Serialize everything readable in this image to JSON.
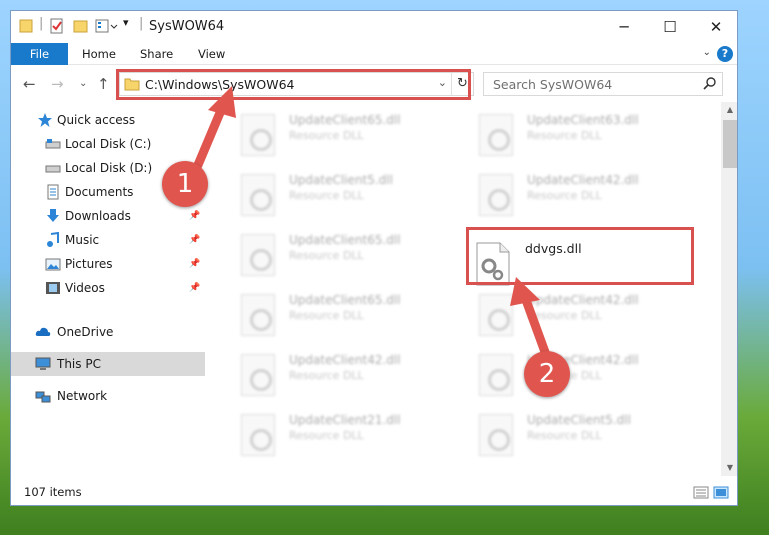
{
  "window": {
    "title": "SysWOW64"
  },
  "ribbon": {
    "tabs": [
      "File",
      "Home",
      "Share",
      "View"
    ]
  },
  "address": {
    "path": "C:\\Windows\\SysWOW64"
  },
  "search": {
    "placeholder": "Search SysWOW64"
  },
  "sidebar": {
    "items": [
      {
        "label": "Quick access",
        "icon": "star-icon"
      },
      {
        "label": "Local Disk (C:)",
        "icon": "drive-icon"
      },
      {
        "label": "Local Disk (D:)",
        "icon": "drive-icon"
      },
      {
        "label": "Documents",
        "icon": "documents-icon"
      },
      {
        "label": "Downloads",
        "icon": "download-icon"
      },
      {
        "label": "Music",
        "icon": "music-icon"
      },
      {
        "label": "Pictures",
        "icon": "pictures-icon"
      },
      {
        "label": "Videos",
        "icon": "videos-icon"
      },
      {
        "label": "OneDrive",
        "icon": "cloud-icon"
      },
      {
        "label": "This PC",
        "icon": "pc-icon"
      },
      {
        "label": "Network",
        "icon": "network-icon"
      }
    ]
  },
  "content": {
    "ghost_files": [
      {
        "name": "UpdateClient65.dll",
        "type": "Resource DLL"
      },
      {
        "name": "UpdateClient63.dll",
        "type": "Resource DLL"
      },
      {
        "name": "UpdateClient5.dll",
        "type": "Resource DLL"
      },
      {
        "name": "UpdateClient42.dll",
        "type": "Resource DLL"
      },
      {
        "name": "UpdateClient65.dll",
        "type": "Resource DLL"
      },
      {
        "name": "UpdateClient65.dll",
        "type": "Resource DLL"
      },
      {
        "name": "UpdateClient42.dll",
        "type": "Resource DLL"
      },
      {
        "name": "UpdateClient42.dll",
        "type": "Resource DLL"
      },
      {
        "name": "UpdateClient42.dll",
        "type": "Resource DLL"
      },
      {
        "name": "UpdateClient21.dll",
        "type": "Resource DLL"
      },
      {
        "name": "UpdateClient5.dll",
        "type": "Resource DLL"
      }
    ],
    "highlighted_file": {
      "name": "ddvgs.dll"
    }
  },
  "status": {
    "item_count": "107 items"
  },
  "annotations": {
    "step1": "1",
    "step2": "2",
    "color": "#d9514e"
  }
}
